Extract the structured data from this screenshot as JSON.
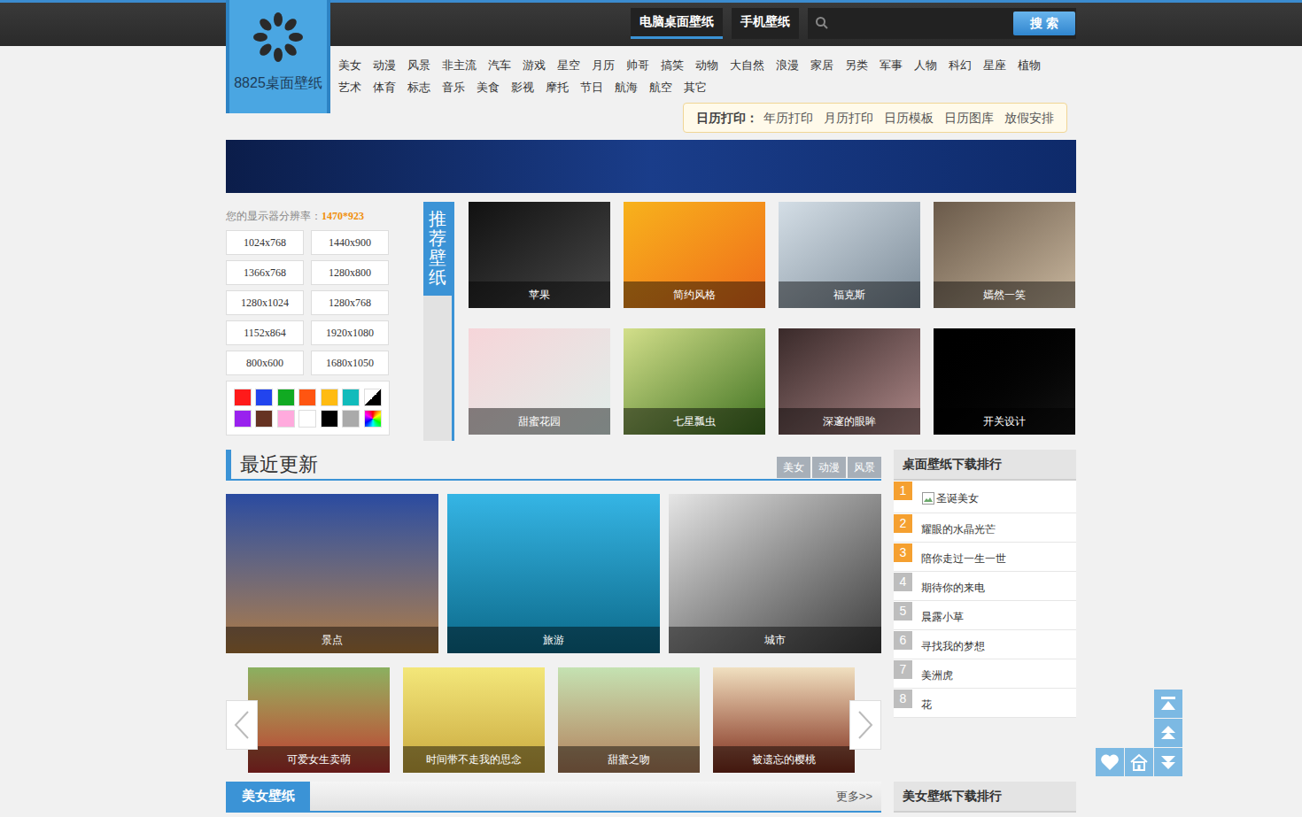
{
  "logo": {
    "text": "8825桌面壁纸"
  },
  "nav_tabs": [
    {
      "label": "电脑桌面壁纸",
      "selected": true
    },
    {
      "label": "手机壁纸",
      "selected": false
    }
  ],
  "search": {
    "button": "搜 索"
  },
  "categories": [
    [
      "美女",
      "动漫",
      "风景",
      "非主流",
      "汽车",
      "游戏",
      "星空",
      "月历",
      "帅哥",
      "搞笑",
      "动物",
      "大自然",
      "浪漫",
      "家居",
      "另类",
      "军事",
      "人物",
      "科幻",
      "星座",
      "植物"
    ],
    [
      "艺术",
      "体育",
      "标志",
      "音乐",
      "美食",
      "影视",
      "摩托",
      "节日",
      "航海",
      "航空",
      "其它"
    ]
  ],
  "calendar_print": {
    "label": "日历打印：",
    "links": [
      "年历打印",
      "月历打印",
      "日历模板",
      "日历图库",
      "放假安排"
    ]
  },
  "resolution": {
    "label": "您的显示器分辨率：",
    "value": "1470*923",
    "options": [
      "1024x768",
      "1440x900",
      "1366x768",
      "1280x800",
      "1280x1024",
      "1280x768",
      "1152x864",
      "1920x1080",
      "800x600",
      "1680x1050"
    ]
  },
  "color_filters": [
    {
      "kind": "solid",
      "color": "#ff1a1a"
    },
    {
      "kind": "solid",
      "color": "#2244ee"
    },
    {
      "kind": "solid",
      "color": "#11aa22"
    },
    {
      "kind": "solid",
      "color": "#ff5511"
    },
    {
      "kind": "solid",
      "color": "#ffbb11"
    },
    {
      "kind": "solid",
      "color": "#11bbbb"
    },
    {
      "kind": "split",
      "color": "#000000"
    },
    {
      "kind": "solid",
      "color": "#9922ee"
    },
    {
      "kind": "solid",
      "color": "#663322"
    },
    {
      "kind": "solid",
      "color": "#ffaadd"
    },
    {
      "kind": "solid",
      "color": "#ffffff"
    },
    {
      "kind": "solid",
      "color": "#000000"
    },
    {
      "kind": "solid",
      "color": "#aaaaaa"
    },
    {
      "kind": "rainbow",
      "color": "#ff0000"
    }
  ],
  "recommended": {
    "title": "推荐壁纸",
    "items": [
      "苹果",
      "简约风格",
      "福克斯",
      "嫣然一笑",
      "甜蜜花园",
      "七星瓢虫",
      "深邃的眼眸",
      "开关设计"
    ]
  },
  "recent": {
    "title": "最近更新",
    "tabs": [
      "美女",
      "动漫",
      "风景"
    ],
    "featured": [
      "景点",
      "旅游",
      "城市"
    ],
    "carousel": [
      "可爱女生卖萌",
      "时间带不走我的思念",
      "甜蜜之吻",
      "被遗忘的樱桃"
    ]
  },
  "beauty_section": {
    "title": "美女壁纸",
    "more": "更多>>"
  },
  "ranking": {
    "title": "桌面壁纸下载排行",
    "items": [
      {
        "rank": "1",
        "name": "圣诞美女",
        "top": true,
        "broken_image": true
      },
      {
        "rank": "2",
        "name": "耀眼的水晶光芒",
        "top": true,
        "broken_image": false
      },
      {
        "rank": "3",
        "name": "陪你走过一生一世",
        "top": true,
        "broken_image": false
      },
      {
        "rank": "4",
        "name": "期待你的来电",
        "top": false,
        "broken_image": false
      },
      {
        "rank": "5",
        "name": "晨露小草",
        "top": false,
        "broken_image": false
      },
      {
        "rank": "6",
        "name": "寻找我的梦想",
        "top": false,
        "broken_image": false
      },
      {
        "rank": "7",
        "name": "美洲虎",
        "top": false,
        "broken_image": false
      },
      {
        "rank": "8",
        "name": "花",
        "top": false,
        "broken_image": false
      }
    ]
  },
  "beauty_ranking": {
    "title": "美女壁纸下载排行"
  }
}
